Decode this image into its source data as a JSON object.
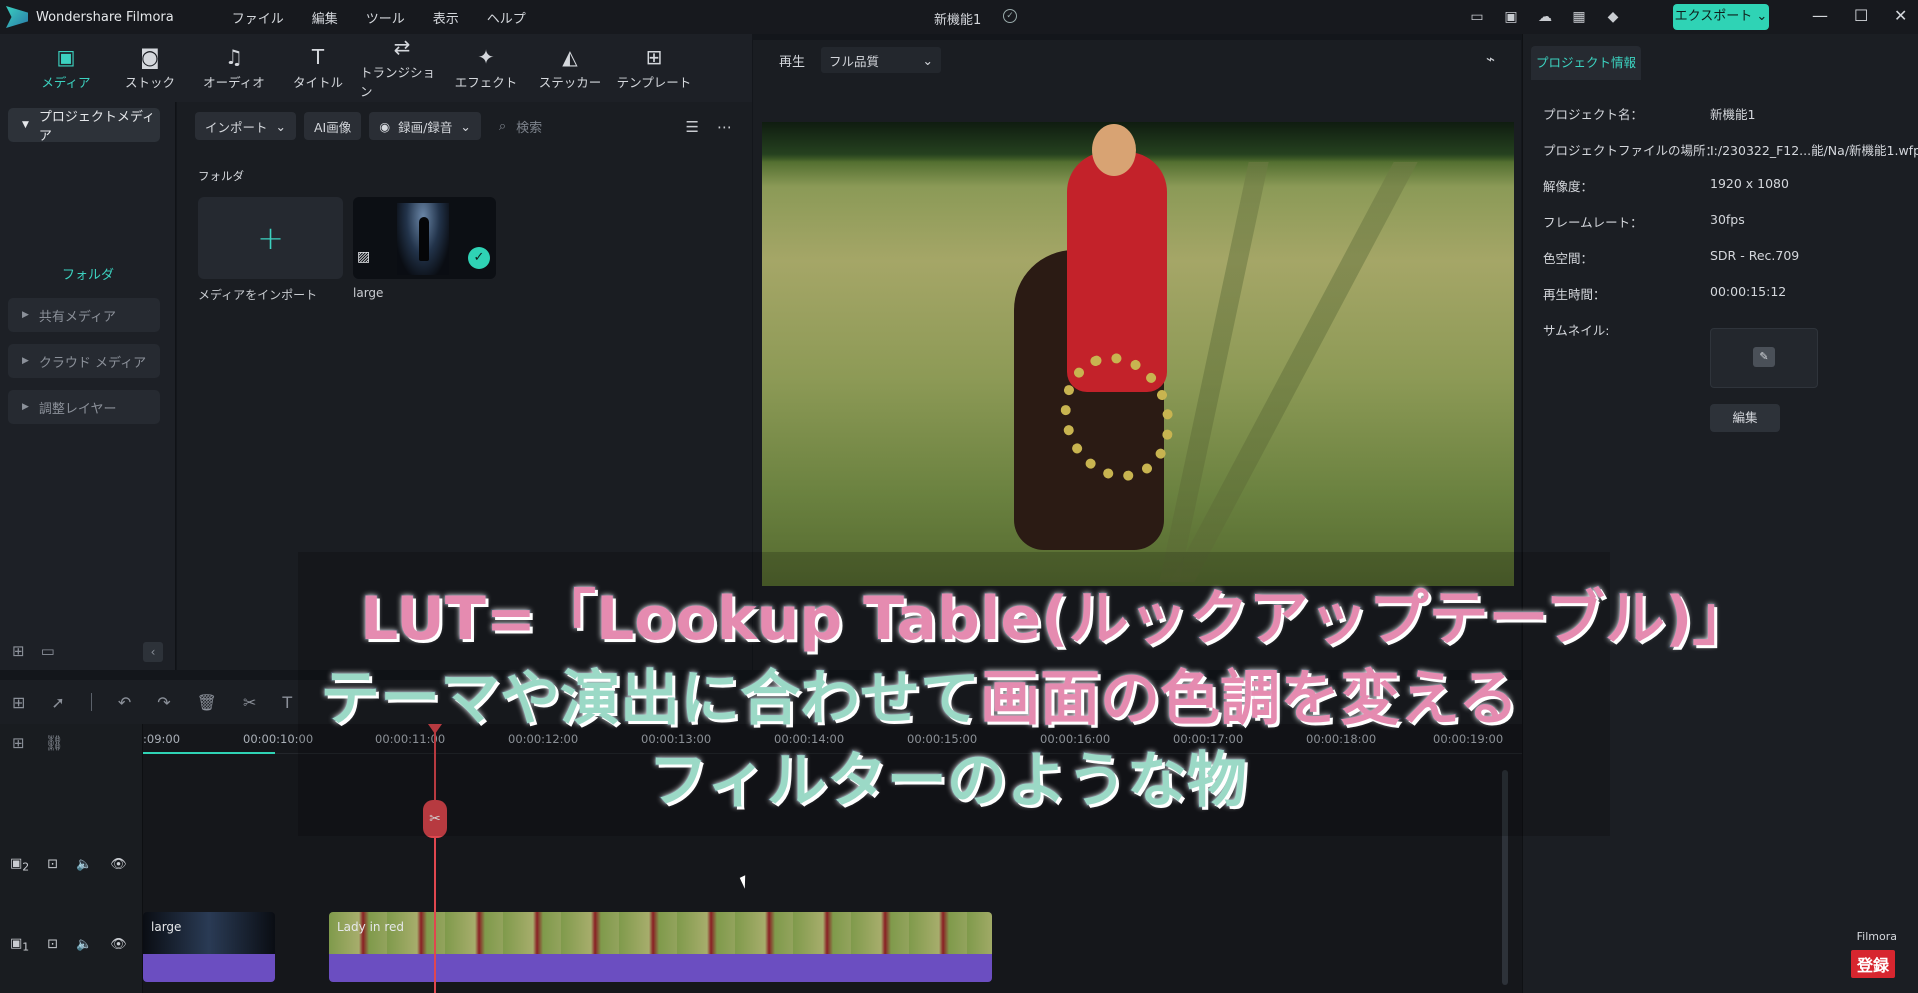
{
  "app": {
    "name": "Wondershare Filmora",
    "project_title": "新機能1"
  },
  "menu": [
    "ファイル",
    "編集",
    "ツール",
    "表示",
    "ヘルプ"
  ],
  "export_label": "エクスポート",
  "media_toolbar": [
    {
      "label": "メディア",
      "icon": "media-icon"
    },
    {
      "label": "ストック",
      "icon": "stock-icon"
    },
    {
      "label": "オーディオ",
      "icon": "music-note-icon"
    },
    {
      "label": "タイトル",
      "icon": "title-icon"
    },
    {
      "label": "トランジション",
      "icon": "transition-icon"
    },
    {
      "label": "エフェクト",
      "icon": "effect-icon"
    },
    {
      "label": "ステッカー",
      "icon": "sticker-icon"
    },
    {
      "label": "テンプレート",
      "icon": "template-icon"
    }
  ],
  "sidebar": {
    "project_media": "プロジェクトメディア",
    "folder": "フォルダ",
    "items": [
      "共有メディア",
      "クラウド メディア",
      "調整レイヤー"
    ]
  },
  "media_browser": {
    "import": "インポート",
    "ai_image": "AI画像",
    "record": "録画/録音",
    "search_placeholder": "検索",
    "section": "フォルダ",
    "import_label": "メディアをインポート",
    "media_label": "large"
  },
  "player": {
    "label": "再生",
    "quality": "フル品質"
  },
  "properties": {
    "tab": "プロジェクト情報",
    "rows": [
      {
        "k": "プロジェクト名：",
        "v": "新機能1"
      },
      {
        "k": "プロジェクトファイルの場所：",
        "v": "I:/230322_F12...能/Na/新機能1.wfp"
      },
      {
        "k": "解像度：",
        "v": "1920 x 1080"
      },
      {
        "k": "フレームレート：",
        "v": "30fps"
      },
      {
        "k": "色空間：",
        "v": "SDR - Rec.709"
      },
      {
        "k": "再生時間：",
        "v": "00:00:15:12"
      },
      {
        "k": "サムネイル:",
        "v": ""
      }
    ],
    "edit": "編集"
  },
  "timeline": {
    "ticks": [
      ":09:00",
      "00:00:10:00",
      "00:00:11:00",
      "00:00:12:00",
      "00:00:13:00",
      "00:00:14:00",
      "00:00:15:00",
      "00:00:16:00",
      "00:00:17:00",
      "00:00:18:00",
      "00:00:19:00"
    ],
    "track2": "2",
    "track1": "1",
    "clips": [
      {
        "name": "large"
      },
      {
        "name": "Lady in red"
      }
    ]
  },
  "caption": {
    "line1": "LUT=「Lookup Table(ルックアップテーブル)」",
    "line2a": "テーマや演出に合わせて",
    "line2b": "画面の色調を変える",
    "line3": "フィルターのような物"
  },
  "watermark": {
    "brand": "Filmora",
    "subscribe": "登録"
  },
  "colors": {
    "accent": "#2fd3b5",
    "playhead": "#e0474f",
    "clip": "#6b4ec1"
  }
}
